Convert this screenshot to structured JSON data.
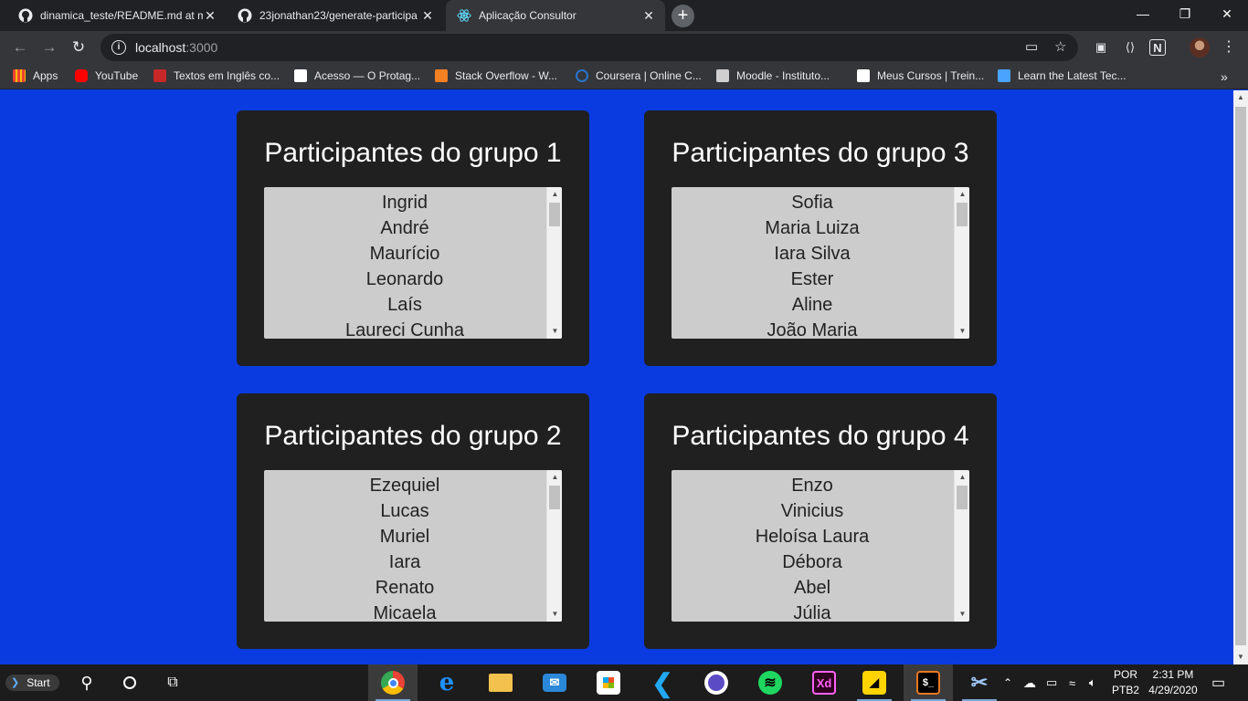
{
  "browser": {
    "tabs": [
      {
        "title": "dinamica_teste/README.md at m",
        "icon": "github-icon",
        "active": false
      },
      {
        "title": "23jonathan23/generate-participa",
        "icon": "github-icon",
        "active": false
      },
      {
        "title": "Aplicação Consultor",
        "icon": "react-icon",
        "active": true
      }
    ],
    "new_tab": "+",
    "url_host": "localhost",
    "url_port": ":3000",
    "bookmarks": [
      {
        "label": "Apps",
        "color": "#ea4335"
      },
      {
        "label": "YouTube",
        "color": "#ff0000"
      },
      {
        "label": "Textos em Inglês co...",
        "color": "#c62828"
      },
      {
        "label": "Acesso — O Protag...",
        "color": "#ffffff"
      },
      {
        "label": "Stack Overflow - W...",
        "color": "#f48024"
      },
      {
        "label": "Coursera | Online C...",
        "color": "#2a73cc"
      },
      {
        "label": "Moodle - Instituto...",
        "color": "#cfcfcf"
      },
      {
        "label": "Meus Cursos | Trein...",
        "color": "#ffffff"
      },
      {
        "label": "Learn the Latest Tec...",
        "color": "#4aa3ff"
      }
    ]
  },
  "page": {
    "background": "#0a3be0",
    "groups": [
      {
        "title": "Participantes do grupo 1",
        "members": [
          "Ingrid",
          "André",
          "Maurício",
          "Leonardo",
          "Laís",
          "Laureci Cunha"
        ]
      },
      {
        "title": "Participantes do grupo 3",
        "members": [
          "Sofia",
          "Maria Luiza",
          "Iara Silva",
          "Ester",
          "Aline",
          "João Maria"
        ]
      },
      {
        "title": "Participantes do grupo 2",
        "members": [
          "Ezequiel",
          "Lucas",
          "Muriel",
          "Iara",
          "Renato",
          "Micaela"
        ]
      },
      {
        "title": "Participantes do grupo 4",
        "members": [
          "Enzo",
          "Vinicius",
          "Heloísa Laura",
          "Débora",
          "Abel",
          "Júlia"
        ]
      }
    ]
  },
  "taskbar": {
    "start_label": "Start",
    "language": "POR",
    "keyboard": "PTB2",
    "time": "2:31 PM",
    "date": "4/29/2020"
  }
}
